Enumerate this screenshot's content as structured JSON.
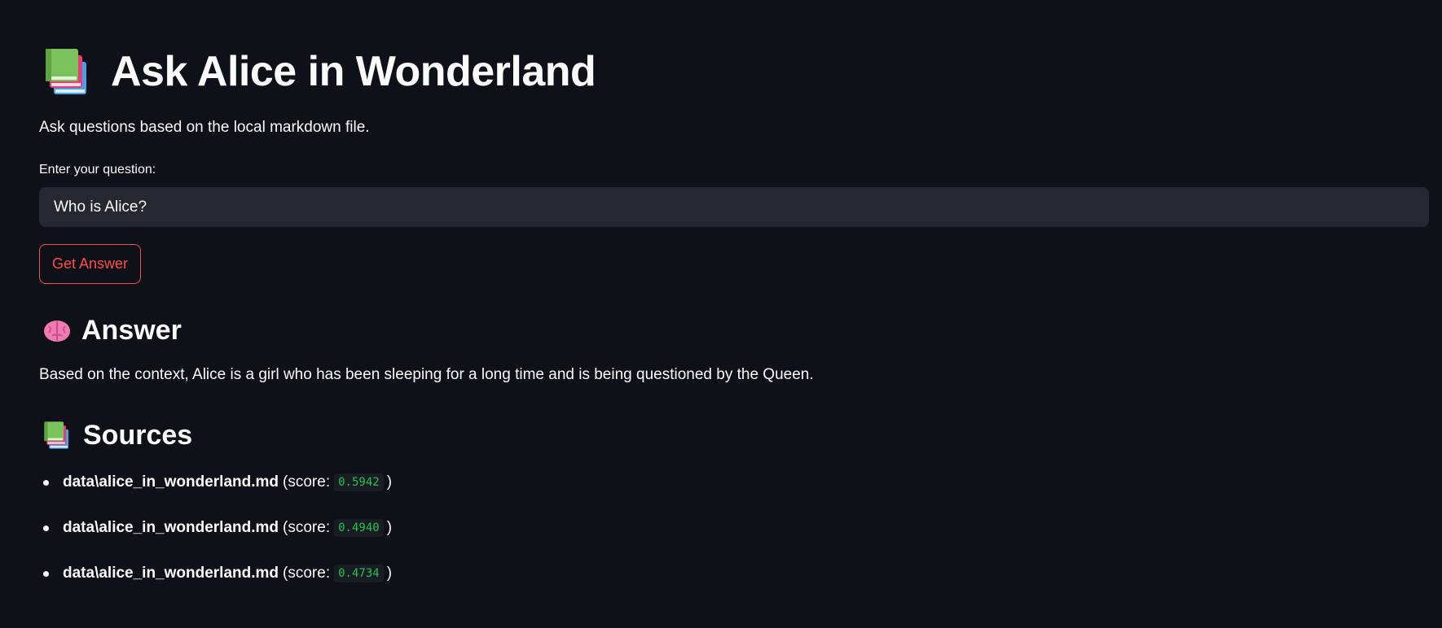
{
  "page": {
    "title": "Ask Alice in Wonderland",
    "title_icon": "books-icon",
    "subtitle": "Ask questions based on the local markdown file."
  },
  "question": {
    "label": "Enter your question:",
    "value": "Who is Alice?",
    "placeholder": ""
  },
  "button": {
    "label": "Get Answer",
    "color": "#ff4b4b"
  },
  "answer": {
    "heading": "Answer",
    "icon": "brain-icon",
    "text": "Based on the context, Alice is a girl who has been sleeping for a long time and is being questioned by the Queen."
  },
  "sources": {
    "heading": "Sources",
    "icon": "books-icon",
    "items": [
      {
        "name": "data\\alice_in_wonderland.md",
        "prefix": "(score:",
        "score": "0.5942",
        "suffix": ")"
      },
      {
        "name": "data\\alice_in_wonderland.md",
        "prefix": "(score:",
        "score": "0.4940",
        "suffix": ")"
      },
      {
        "name": "data\\alice_in_wonderland.md",
        "prefix": "(score:",
        "score": "0.4734",
        "suffix": ")"
      }
    ]
  },
  "colors": {
    "background": "#0e1117",
    "text": "#fafafa",
    "input_bg": "#262730",
    "accent": "#ff4b4b",
    "score_text": "#21c354"
  }
}
